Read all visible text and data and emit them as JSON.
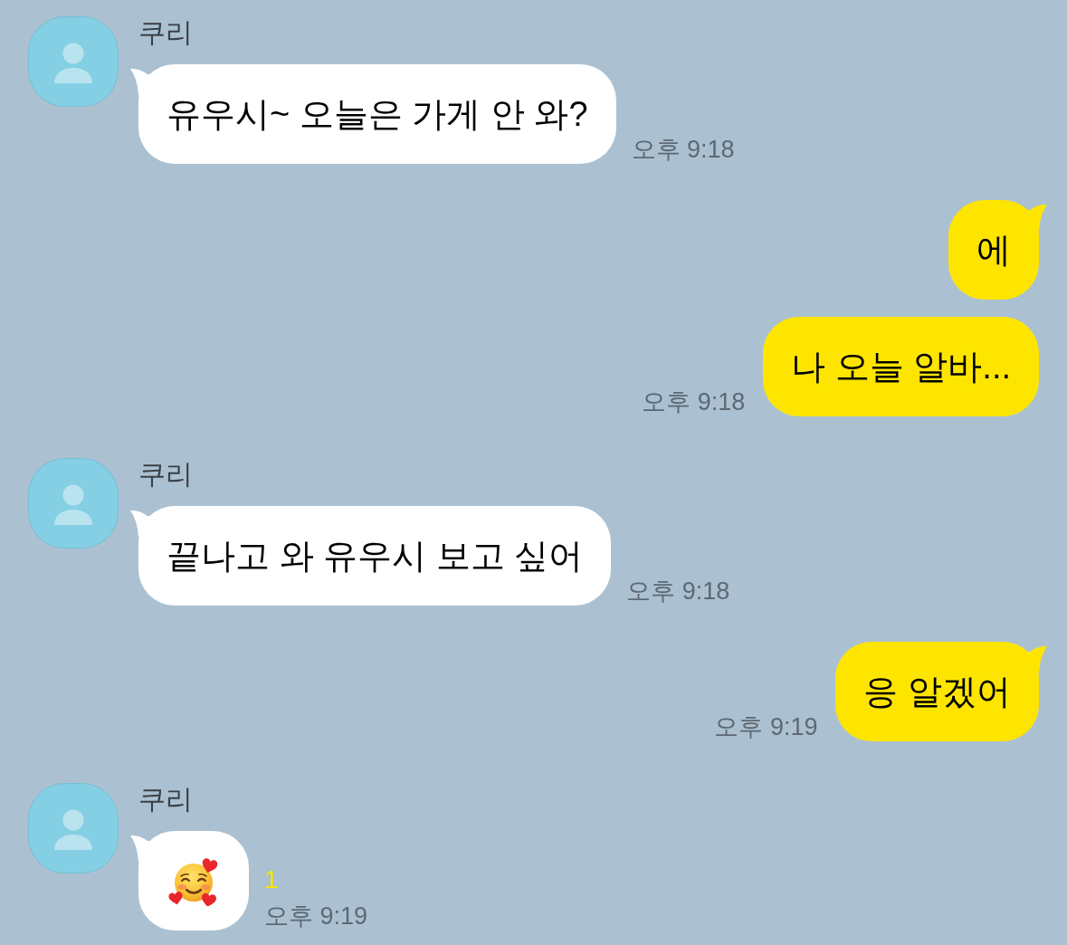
{
  "chat": [
    {
      "kind": "received",
      "sender": "쿠리",
      "bubbles": [
        {
          "kind": "text",
          "text": "유우시~ 오늘은 가게 안 와?"
        }
      ],
      "time": "오후 9:18"
    },
    {
      "kind": "sent",
      "bubbles": [
        {
          "kind": "text",
          "text": "에"
        },
        {
          "kind": "text",
          "text": "나 오늘 알바..."
        }
      ],
      "time": "오후 9:18"
    },
    {
      "kind": "received",
      "sender": "쿠리",
      "bubbles": [
        {
          "kind": "text",
          "text": "끝나고 와 유우시 보고 싶어"
        }
      ],
      "time": "오후 9:18"
    },
    {
      "kind": "sent",
      "bubbles": [
        {
          "kind": "text",
          "text": "응 알겠어"
        }
      ],
      "time": "오후 9:19"
    },
    {
      "kind": "received",
      "sender": "쿠리",
      "bubbles": [
        {
          "kind": "emoji"
        }
      ],
      "unread": "1",
      "time": "오후 9:19"
    }
  ]
}
